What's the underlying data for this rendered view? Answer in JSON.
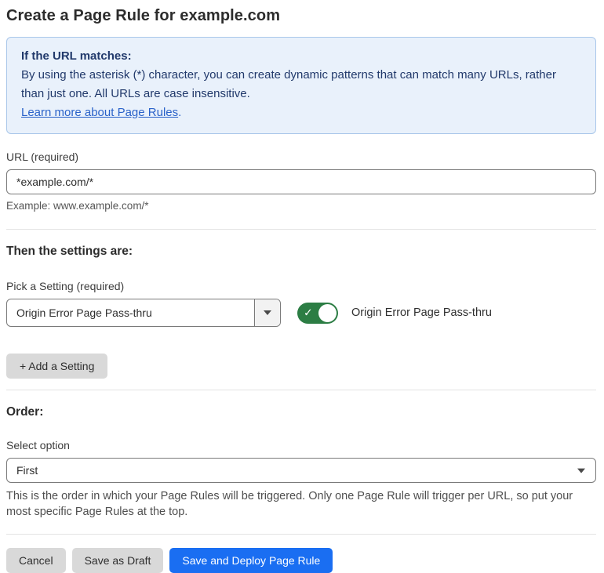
{
  "page": {
    "title": "Create a Page Rule for example.com"
  },
  "info_box": {
    "heading": "If the URL matches:",
    "body": "By using the asterisk (*) character, you can create dynamic patterns that can match many URLs, rather than just one. All URLs are case insensitive.",
    "link_label": "Learn more about Page Rules",
    "link_suffix": "."
  },
  "url_field": {
    "label": "URL (required)",
    "value": "*example.com/*",
    "example": "Example: www.example.com/*"
  },
  "settings_section": {
    "heading": "Then the settings are:",
    "setting_label": "Pick a Setting (required)",
    "setting_value": "Origin Error Page Pass-thru",
    "toggle_label": "Origin Error Page Pass-thru",
    "toggle_state": "on",
    "add_button_label": "+ Add a Setting"
  },
  "order_section": {
    "heading": "Order:",
    "label": "Select option",
    "value": "First",
    "help": "This is the order in which your Page Rules will be triggered. Only one Page Rule will trigger per URL, so put your most specific Page Rules at the top."
  },
  "footer": {
    "cancel_label": "Cancel",
    "save_draft_label": "Save as Draft",
    "save_deploy_label": "Save and Deploy Page Rule"
  },
  "icons": {
    "check": "✓"
  },
  "colors": {
    "primary_blue": "#1a6ef2",
    "toggle_green": "#2c7d44",
    "info_bg": "#e9f1fb",
    "info_border": "#a9c7ea",
    "info_text": "#21396b",
    "link_blue": "#2a62c9",
    "button_gray": "#d9d9d9"
  }
}
